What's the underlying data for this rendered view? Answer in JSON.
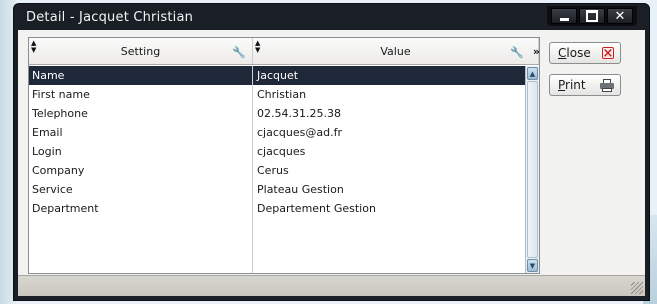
{
  "window": {
    "title": "Detail - Jacquet Christian"
  },
  "table": {
    "columns": {
      "setting": "Setting",
      "value": "Value"
    },
    "rows": [
      {
        "setting": "Name",
        "value": "Jacquet",
        "selected": true
      },
      {
        "setting": "First name",
        "value": "Christian"
      },
      {
        "setting": "Telephone",
        "value": "02.54.31.25.38"
      },
      {
        "setting": "Email",
        "value": "cjacques@ad.fr"
      },
      {
        "setting": "Login",
        "value": "cjacques"
      },
      {
        "setting": "Company",
        "value": "Cerus"
      },
      {
        "setting": "Service",
        "value": "Plateau Gestion"
      },
      {
        "setting": "Department",
        "value": "Departement Gestion"
      }
    ]
  },
  "buttons": {
    "close": {
      "mnemonic": "C",
      "rest": "lose"
    },
    "print": {
      "mnemonic": "P",
      "rest": "rint"
    }
  },
  "icons": {
    "close": "close-x-icon",
    "print": "printer-icon",
    "sort": "sort-icon",
    "filter": "filter-icon",
    "column_chooser": "column-chooser-icon"
  },
  "colors": {
    "selection": "#1e2839",
    "title_bar": "#1a1f26",
    "close_icon": "#d11f1f"
  }
}
